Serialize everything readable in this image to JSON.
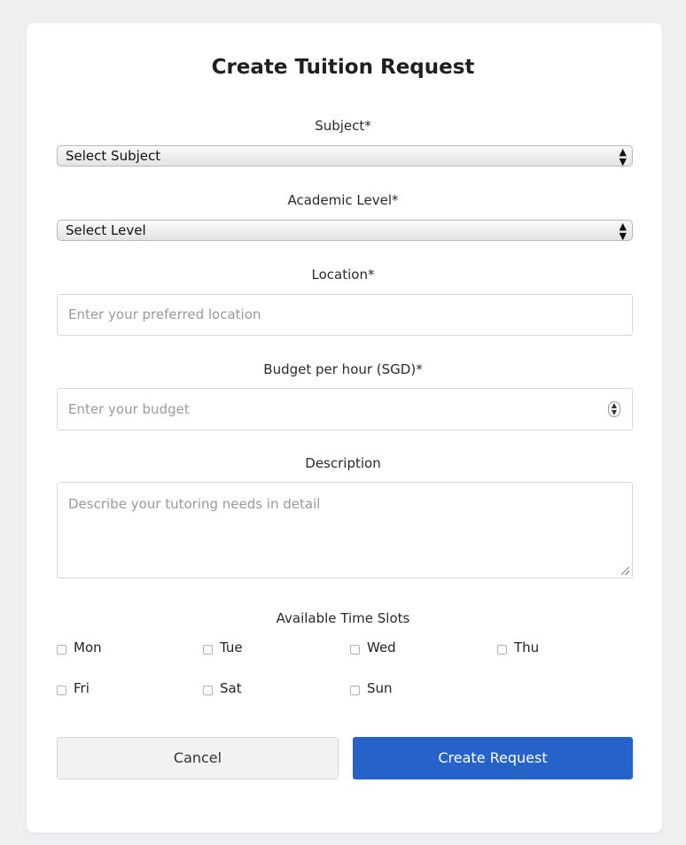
{
  "form": {
    "title": "Create Tuition Request",
    "subject": {
      "label": "Subject*",
      "selected": "Select Subject"
    },
    "level": {
      "label": "Academic Level*",
      "selected": "Select Level"
    },
    "location": {
      "label": "Location*",
      "placeholder": "Enter your preferred location"
    },
    "budget": {
      "label": "Budget per hour (SGD)*",
      "placeholder": "Enter your budget"
    },
    "description": {
      "label": "Description",
      "placeholder": "Describe your tutoring needs in detail"
    },
    "time_slots": {
      "label": "Available Time Slots",
      "days": [
        "Mon",
        "Tue",
        "Wed",
        "Thu",
        "Fri",
        "Sat",
        "Sun"
      ]
    },
    "buttons": {
      "cancel": "Cancel",
      "create": "Create Request"
    }
  },
  "colors": {
    "primary": "#2563c9",
    "background": "#eeeff1",
    "card": "#ffffff"
  }
}
